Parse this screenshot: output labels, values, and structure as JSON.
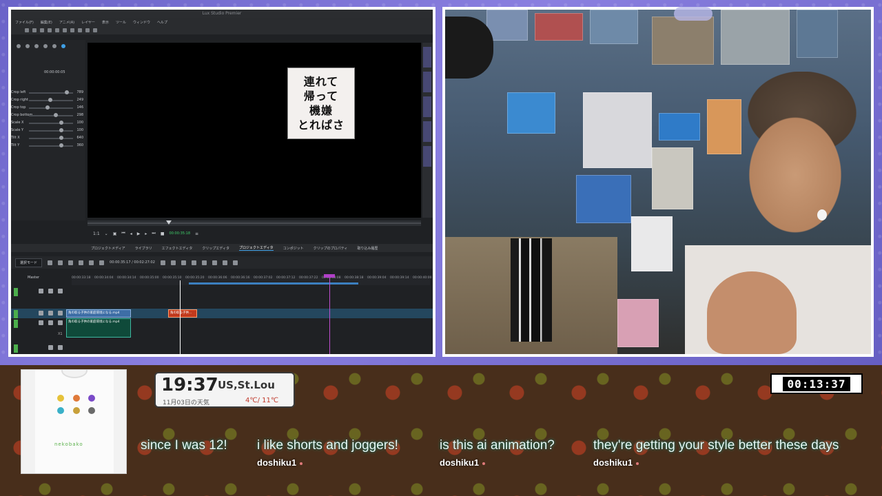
{
  "editor": {
    "title": "Lux Studio Premier",
    "menu": [
      "ファイル(F)",
      "編集(E)",
      "アニメ(A)",
      "レイヤー",
      "表示",
      "ツール",
      "ウィンドウ",
      "ヘルプ"
    ],
    "timecode": "00:00:00:05",
    "properties": [
      {
        "label": "Crop left",
        "value": "789"
      },
      {
        "label": "Crop right",
        "value": "249"
      },
      {
        "label": "Crop top",
        "value": "146"
      },
      {
        "label": "Crop bottom",
        "value": "298"
      },
      {
        "label": "Scale X",
        "value": "100"
      },
      {
        "label": "Scale Y",
        "value": "100"
      },
      {
        "label": "Tilt X",
        "value": "640"
      },
      {
        "label": "Tilt Y",
        "value": "360"
      }
    ],
    "thumbnail_text": [
      "連れて",
      "帰って",
      "機嫌",
      "とれぱさ"
    ],
    "transport_time": "00:00:35:18",
    "zoom": "1:1",
    "tabs": [
      "プロジェクトメディア",
      "ライブラリ",
      "エフェクトエディタ",
      "クリップエディタ",
      "プロジェクトエディタ",
      "コンポジット",
      "クリップのプロパティ",
      "取り込み履歴"
    ],
    "mode": "選択モード",
    "timeline_time": "00:00:35:17 / 00:02:27:02",
    "ruler_ticks": [
      "00:00:33:18",
      "00:00:34:04",
      "00:00:34:14",
      "00:00:35:00",
      "00:00:35:10",
      "00:00:35:20",
      "00:00:36:06",
      "00:00:36:16",
      "00:00:37:02",
      "00:00:37:12",
      "00:00:37:22",
      "00:00:38:08",
      "00:00:38:18",
      "00:00:39:04",
      "00:00:39:14",
      "00:00:40:00"
    ],
    "master_label": "Master",
    "clips": {
      "video_a": "角の取る子供の家庭環境になる.mp4",
      "video_b": "角の取る子供...",
      "audio_a": "角の取る子供の家庭環境になる.mp4",
      "track_label": "X1"
    }
  },
  "overlay": {
    "clock": {
      "time": "19:37",
      "location": "US,St.Lou",
      "date": "11月03日の天気",
      "temp": "4℃/ 11℃"
    },
    "timer": "00:13:37",
    "shirt_word": "nekobako",
    "chat": [
      {
        "message": "since I was 12!",
        "user": ""
      },
      {
        "message": "i like shorts and joggers!",
        "user": "doshiku1"
      },
      {
        "message": "is this ai animation?",
        "user": "doshiku1"
      },
      {
        "message": "they're getting your style better these days",
        "user": "doshiku1"
      }
    ]
  },
  "colors": {
    "accent": "#3fa0e6",
    "selection": "#24475e",
    "clip_red": "#c23a1d",
    "frame": "#ffffff"
  }
}
